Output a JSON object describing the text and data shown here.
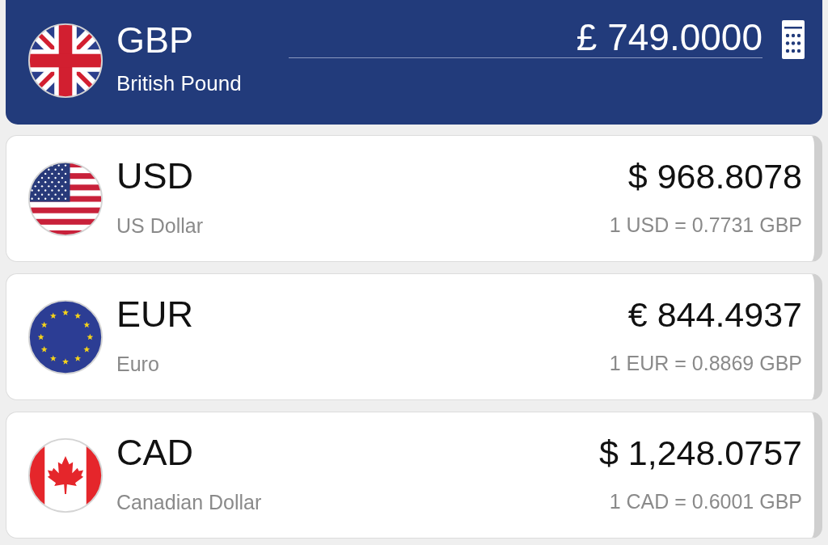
{
  "base": {
    "kind": "uk",
    "code": "GBP",
    "name": "British Pound",
    "amount": "£ 749.0000"
  },
  "currencies": [
    {
      "kind": "us",
      "code": "USD",
      "name": "US Dollar",
      "amount": "$ 968.8078",
      "rate": "1 USD = 0.7731 GBP"
    },
    {
      "kind": "eu",
      "code": "EUR",
      "name": "Euro",
      "amount": "€ 844.4937",
      "rate": "1 EUR = 0.8869 GBP"
    },
    {
      "kind": "ca",
      "code": "CAD",
      "name": "Canadian Dollar",
      "amount": "$ 1,248.0757",
      "rate": "1 CAD = 0.6001 GBP"
    }
  ]
}
